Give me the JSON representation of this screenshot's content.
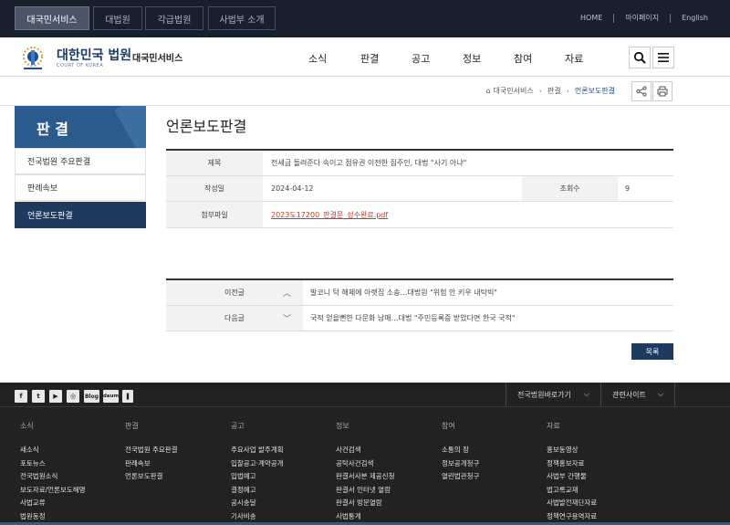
{
  "topbar": {
    "tabs": [
      "대국민서비스",
      "대법원",
      "각급법원",
      "사법부 소개"
    ],
    "links": [
      "HOME",
      "마이페이지",
      "English"
    ]
  },
  "header": {
    "brand": "대한민국 법원",
    "brand_sub": "COURT OF KOREA",
    "service": "대국민서비스",
    "menu": [
      "소식",
      "판결",
      "공고",
      "정보",
      "참여",
      "자료"
    ]
  },
  "breadcrumb": [
    "대국민서비스",
    "판결",
    "언론보도판결"
  ],
  "sidebar": {
    "title": "판 결",
    "items": [
      "전국법원 주요판결",
      "판례속보",
      "언론보도판결"
    ]
  },
  "main": {
    "title": "언론보도판결",
    "subject_label": "제목",
    "subject": "전세금 돌려준다 속이고 점유권 이전한 집주인, 대법 \"사기 아냐\"",
    "date_label": "작성일",
    "date": "2024-04-12",
    "views_label": "조회수",
    "views": "9",
    "attach_label": "첨부파일",
    "attachment": "2023도17200_판결문_성수완료.pdf",
    "prev_label": "이전글",
    "prev": "발코니 턱 해체에 아랫집 소송…대법원 \"위험 안 키우 내탁빅\"",
    "next_label": "다음글",
    "next": "국적 얻을뻔한 다문화 남매…대법 \"주민등록증 받았다면 한국 국적\"",
    "list_button": "목록"
  },
  "footer": {
    "social": [
      "f",
      "t",
      "▶",
      "◎",
      "Blog",
      "daum",
      "❚"
    ],
    "selects": [
      "전국법원바로가기",
      "관련사이트"
    ],
    "columns": [
      {
        "head": "소식",
        "links": [
          "새소식",
          "포토뉴스",
          "전국법원소식",
          "보도자료/언론보도해명",
          "사법교류",
          "법원동정"
        ]
      },
      {
        "head": "판결",
        "links": [
          "전국법원 주요판결",
          "판례속보",
          "언론보도판결"
        ]
      },
      {
        "head": "공고",
        "links": [
          "주요사업 발주계획",
          "입찰공고·계약공개",
          "입법예고",
          "결정예고",
          "공시송달",
          "기사비송"
        ]
      },
      {
        "head": "정보",
        "links": [
          "사건검색",
          "공탁사건검색",
          "판결서사본 제공신청",
          "판결서 인터넷 열람",
          "판결서 방문열람",
          "사법통계"
        ]
      },
      {
        "head": "참여",
        "links": [
          "소통의 장",
          "정보공개청구",
          "열린법관청구"
        ]
      },
      {
        "head": "자료",
        "links": [
          "홍보동영상",
          "정책홍보자료",
          "사법부 간행물",
          "법고록교재",
          "사법발전재단자료",
          "정책연구용역자료"
        ]
      }
    ]
  },
  "colors": {
    "topbar": "#18202e",
    "brand": "#1e3a6a",
    "nav_active": "#1e3a5f",
    "footer": "#222222",
    "attachment": "#c0392b"
  }
}
